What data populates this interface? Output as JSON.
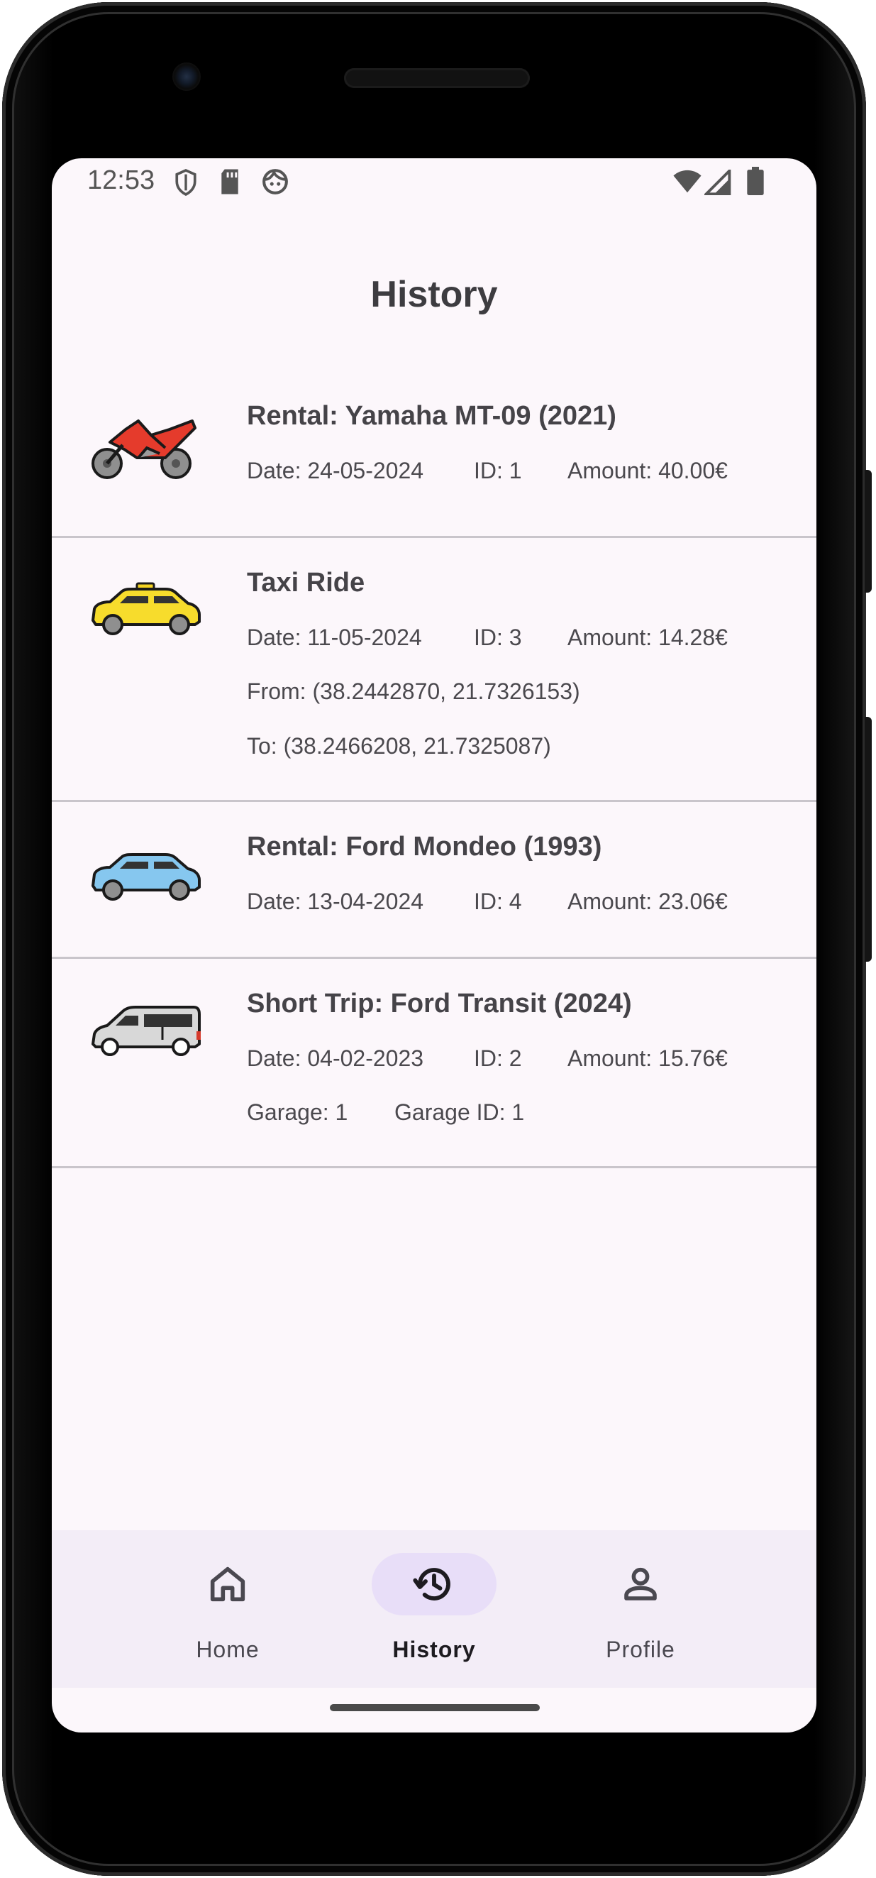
{
  "status_bar": {
    "time": "12:53",
    "left_icons": [
      "shield-icon",
      "sd-card-icon",
      "face-icon"
    ],
    "right_icons": [
      "wifi-icon",
      "signal-icon",
      "battery-icon"
    ]
  },
  "page": {
    "title": "History"
  },
  "history": [
    {
      "icon": "motorcycle-icon",
      "title": "Rental: Yamaha MT-09 (2021)",
      "date": "Date: 24-05-2024",
      "id": "ID: 1",
      "amount": "Amount: 40.00€"
    },
    {
      "icon": "taxi-icon",
      "title": "Taxi Ride",
      "date": "Date: 11-05-2024",
      "id": "ID: 3",
      "amount": "Amount: 14.28€",
      "from": "From: (38.2442870, 21.7326153)",
      "to": "To: (38.2466208, 21.7325087)"
    },
    {
      "icon": "car-icon",
      "title": "Rental: Ford Mondeo (1993)",
      "date": "Date: 13-04-2024",
      "id": "ID: 4",
      "amount": "Amount: 23.06€"
    },
    {
      "icon": "van-icon",
      "title": "Short Trip: Ford Transit (2024)",
      "date": "Date: 04-02-2023",
      "id": "ID: 2",
      "amount": "Amount: 15.76€",
      "garage": "Garage: 1",
      "garage_id": "Garage ID: 1"
    }
  ],
  "bottom_nav": {
    "items": [
      {
        "label": "Home",
        "icon": "home-icon",
        "active": false
      },
      {
        "label": "History",
        "icon": "history-icon",
        "active": true
      },
      {
        "label": "Profile",
        "icon": "person-icon",
        "active": false
      }
    ]
  },
  "colors": {
    "background": "#fcf7fb",
    "nav_background": "#f3edf7",
    "active_pill": "#e8def8",
    "divider": "#c9c5cb"
  }
}
